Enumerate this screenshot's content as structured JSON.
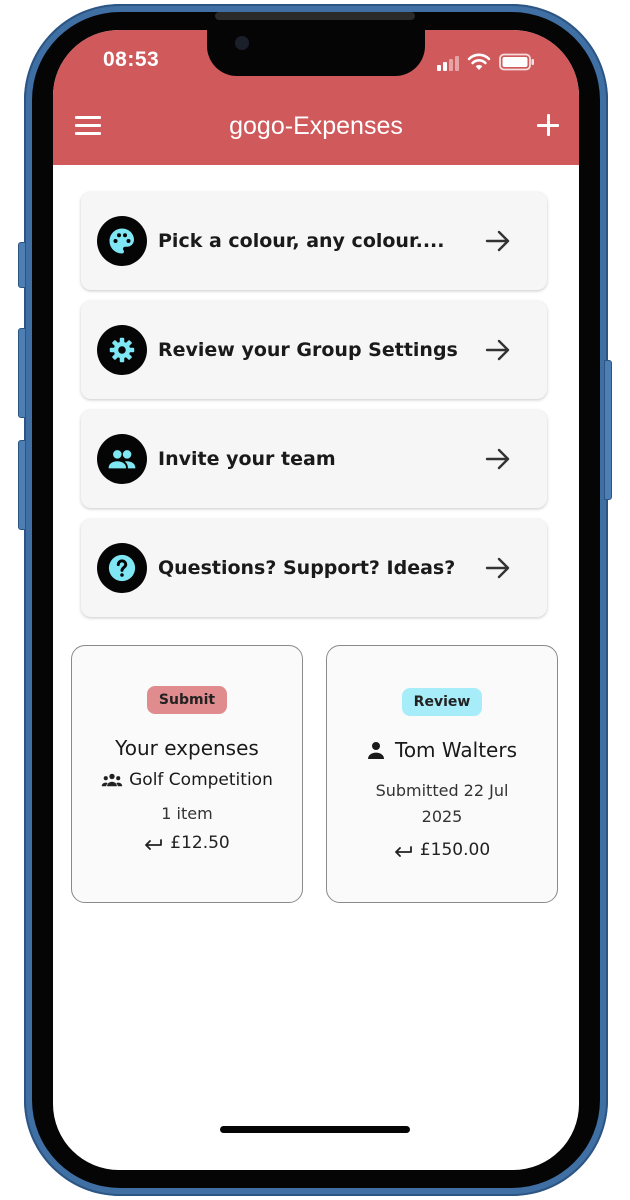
{
  "status_bar": {
    "time": "08:53"
  },
  "app_bar": {
    "title": "gogo-Expenses"
  },
  "colors": {
    "accent": "#cf595b",
    "icon_tint": "#7fe6f4",
    "submit_badge": "#e08c8f",
    "review_badge": "#a7ecf9"
  },
  "actions": [
    {
      "label": "Pick a colour, any colour....",
      "icon": "palette-icon"
    },
    {
      "label": "Review your Group Settings",
      "icon": "gear-icon"
    },
    {
      "label": "Invite your team",
      "icon": "people-icon"
    },
    {
      "label": "Questions? Support? Ideas?",
      "icon": "help-icon"
    }
  ],
  "submit_tile": {
    "badge": "Submit",
    "title": "Your expenses",
    "group": "Golf Competition",
    "items": "1 item",
    "amount": "£12.50"
  },
  "review_tile": {
    "badge": "Review",
    "person": "Tom Walters",
    "submitted": "Submitted 22 Jul 2025",
    "amount": "£150.00"
  }
}
